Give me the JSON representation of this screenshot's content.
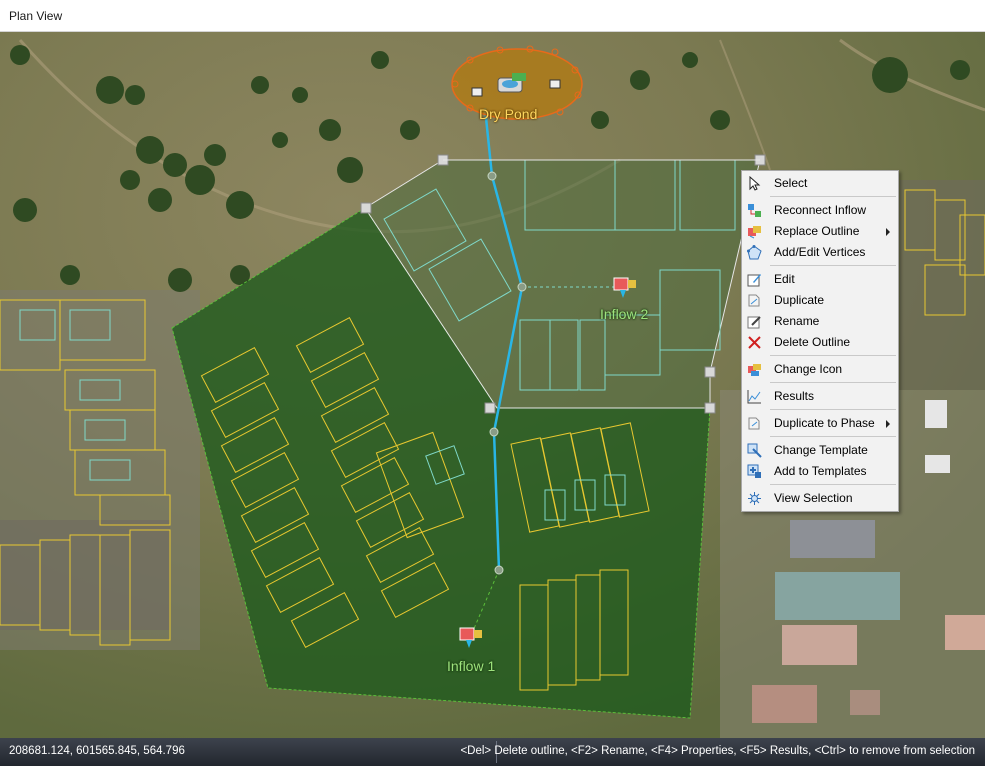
{
  "window": {
    "title": "Plan View"
  },
  "map": {
    "labels": {
      "dry_pond": "Dry Pond",
      "inflow_1": "Inflow 1",
      "inflow_2": "Inflow 2"
    },
    "colors": {
      "catchment_fill": "#1e5a1c",
      "drain_line": "#29b6e6",
      "lot_outline_yellow": "#e8c830",
      "lot_outline_cyan": "#7fd8c8",
      "pond_outline": "#e86a1a"
    }
  },
  "context_menu": {
    "items": [
      {
        "label": "Select",
        "icon": "cursor-arrow-icon"
      },
      {
        "separator": true
      },
      {
        "label": "Reconnect Inflow",
        "icon": "reconnect-inflow-icon"
      },
      {
        "label": "Replace Outline",
        "icon": "replace-outline-icon",
        "submenu": true
      },
      {
        "label": "Add/Edit Vertices",
        "icon": "vertices-icon"
      },
      {
        "separator": true
      },
      {
        "label": "Edit",
        "icon": "edit-icon"
      },
      {
        "label": "Duplicate",
        "icon": "duplicate-icon"
      },
      {
        "label": "Rename",
        "icon": "rename-icon"
      },
      {
        "label": "Delete Outline",
        "icon": "delete-x-icon"
      },
      {
        "separator": true
      },
      {
        "label": "Change Icon",
        "icon": "change-icon-icon"
      },
      {
        "separator": true
      },
      {
        "label": "Results",
        "icon": "results-chart-icon"
      },
      {
        "separator": true
      },
      {
        "label": "Duplicate to Phase",
        "icon": "duplicate-phase-icon",
        "submenu": true
      },
      {
        "separator": true
      },
      {
        "label": "Change Template",
        "icon": "change-template-icon"
      },
      {
        "label": "Add to Templates",
        "icon": "add-template-icon"
      },
      {
        "separator": true
      },
      {
        "label": "View Selection",
        "icon": "view-selection-icon"
      }
    ]
  },
  "status_bar": {
    "coordinates": "208681.124, 601565.845, 564.796",
    "hint": "<Del> Delete outline, <F2> Rename, <F4> Properties, <F5> Results, <Ctrl> to remove from selection"
  }
}
